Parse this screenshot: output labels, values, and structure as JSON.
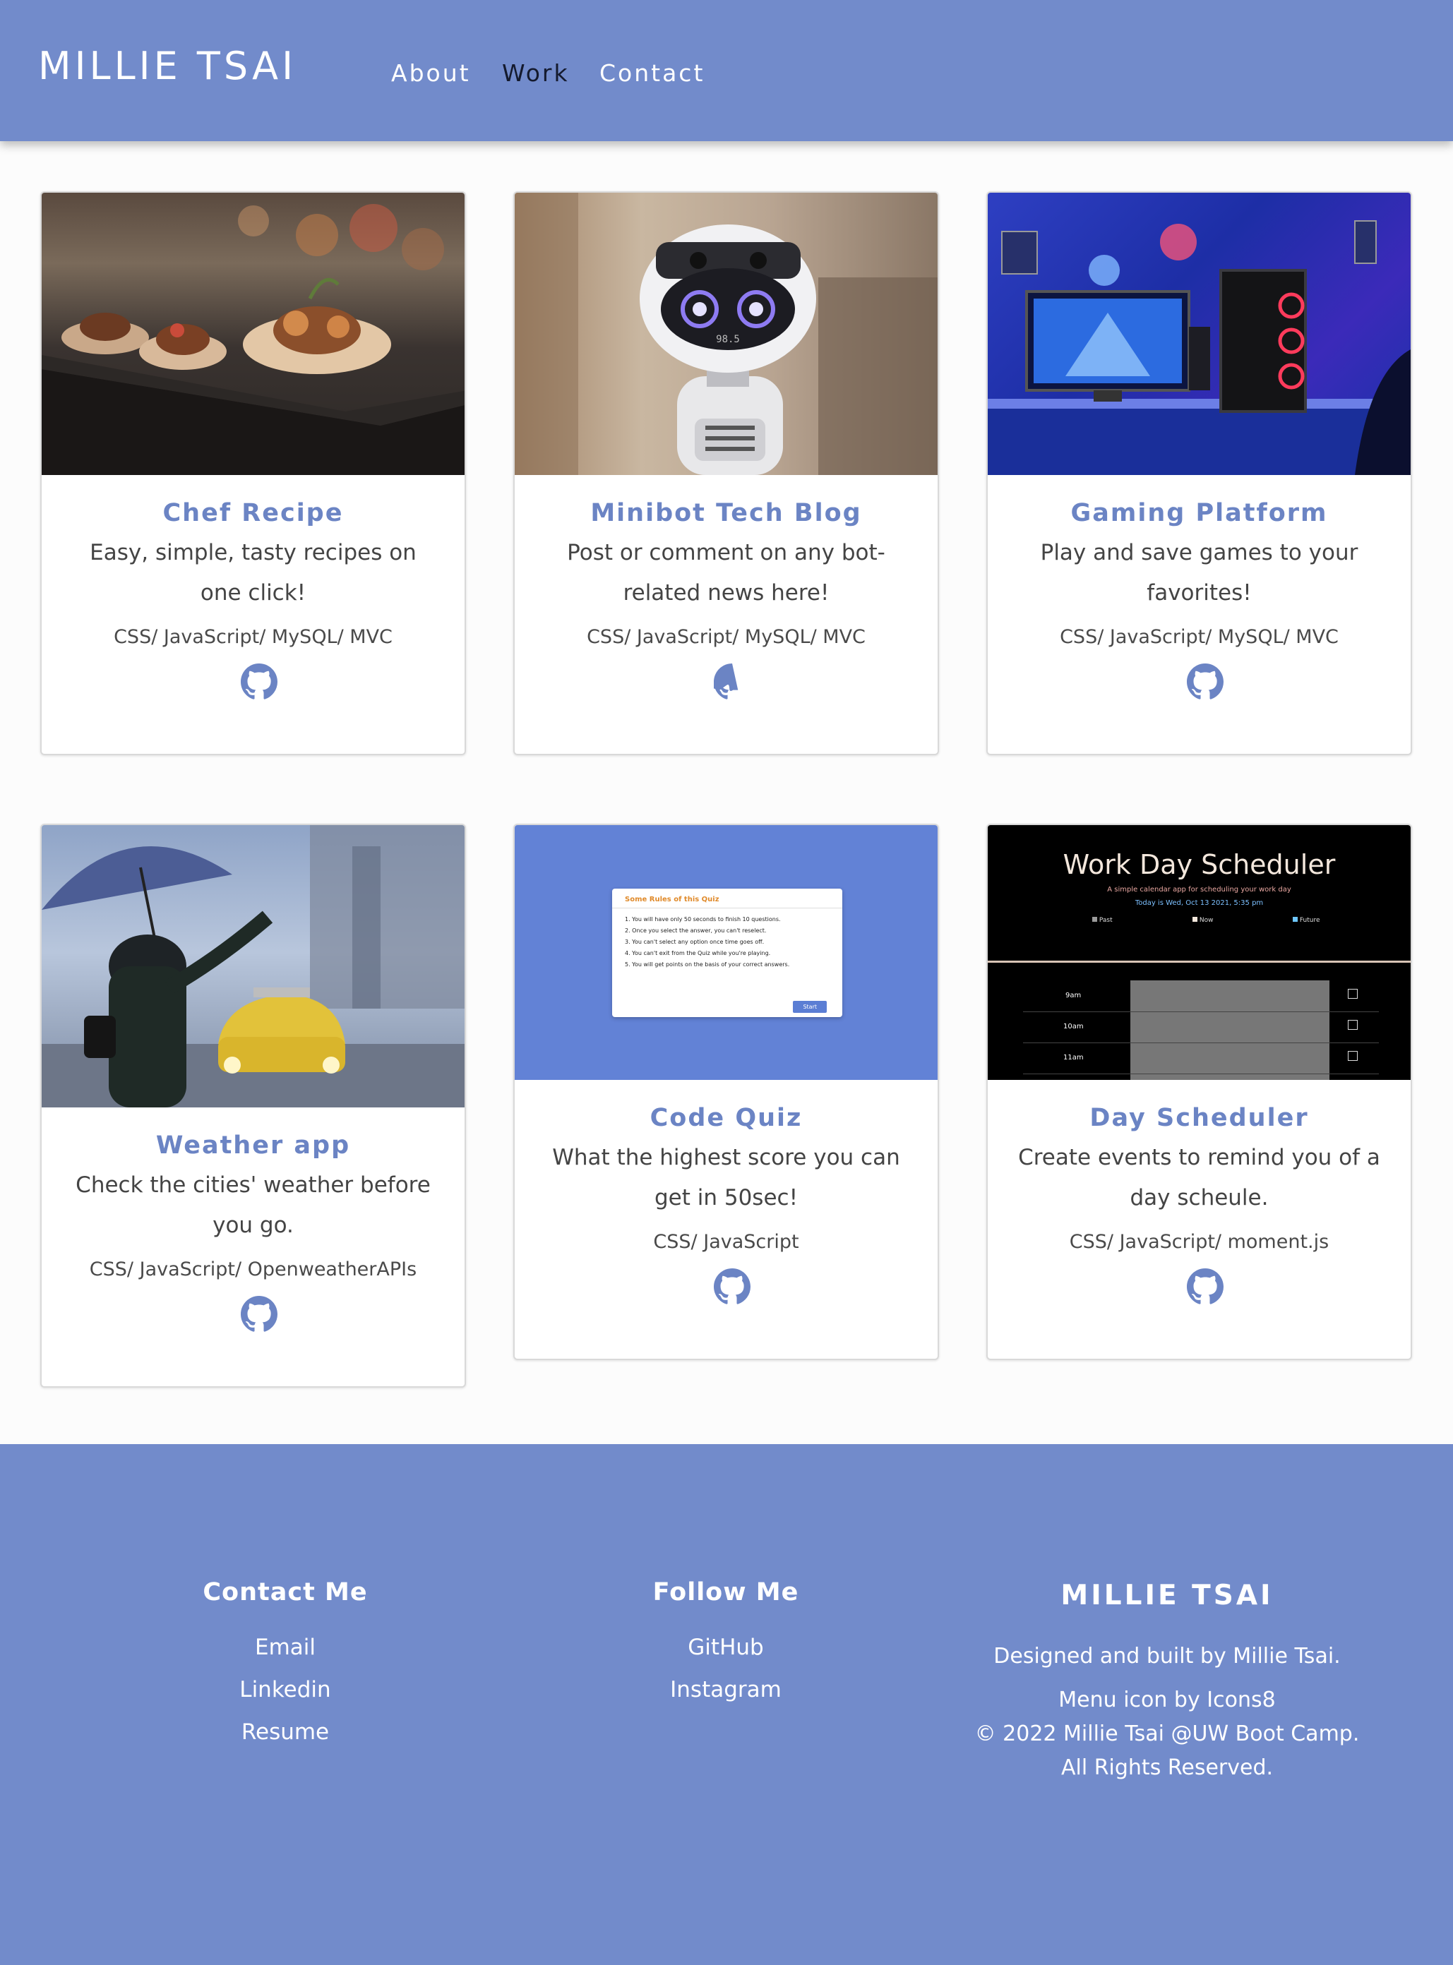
{
  "header": {
    "brand": "MILLIE TSAI",
    "nav": [
      {
        "label": "About"
      },
      {
        "label": "Work"
      },
      {
        "label": "Contact"
      }
    ],
    "active": "Work",
    "color": "#728bcb"
  },
  "projects": [
    {
      "title": "Chef Recipe",
      "description": "Easy, simple, tasty recipes on one click!",
      "tech": "CSS/ JavaScript/ MySQL/ MVC",
      "image": "food-photo",
      "icon": "github-icon"
    },
    {
      "title": "Minibot Tech Blog",
      "description": "Post or comment on any bot-related news here!",
      "tech": "CSS/ JavaScript/ MySQL/ MVC",
      "image": "robot-photo",
      "icon": "github-icon"
    },
    {
      "title": "Gaming Platform",
      "description": "Play and save games to your favorites!",
      "tech": "CSS/ JavaScript/ MySQL/ MVC",
      "image": "gaming-setup-photo",
      "icon": "github-icon"
    },
    {
      "title": "Weather app",
      "description": "Check the cities' weather before you go.",
      "tech": "CSS/ JavaScript/ OpenweatherAPIs",
      "image": "rain-umbrella-photo",
      "icon": "github-icon"
    },
    {
      "title": "Code Quiz",
      "description": "What the highest score you can get in 50sec!",
      "tech": "CSS/ JavaScript",
      "image": "quiz-screenshot",
      "icon": "github-icon"
    },
    {
      "title": "Day Scheduler",
      "description": "Create events to remind you of a day scheule.",
      "tech": "CSS/ JavaScript/ moment.js",
      "image": "scheduler-screenshot",
      "icon": "github-icon"
    }
  ],
  "quiz_preview": {
    "heading": "Some Rules of this Quiz",
    "rules": [
      "1. You will have only 50 seconds to finish 10 questions.",
      "2. Once you select the answer, you can't reselect.",
      "3. You can't select any option once time goes off.",
      "4. You can't exit from the Quiz while you're playing.",
      "5. You will get points on the basis of your correct answers."
    ],
    "button": "Start"
  },
  "scheduler_preview": {
    "title": "Work Day Scheduler",
    "subtitle": "A simple calendar app for scheduling your work day",
    "today": "Today is Wed, Oct 13 2021, 5:35 pm",
    "legend": [
      "Past",
      "Now",
      "Future"
    ],
    "hours": [
      "9am",
      "10am",
      "11am"
    ]
  },
  "robot_preview": {
    "display": "98.5"
  },
  "footer": {
    "contact": {
      "heading": "Contact Me",
      "links": [
        "Email",
        "Linkedin",
        "Resume"
      ]
    },
    "follow": {
      "heading": "Follow Me",
      "links": [
        "GitHub",
        "Instagram"
      ]
    },
    "brand": "MILLIE TSAI",
    "built_by": "Designed and built by Millie Tsai.",
    "credit": "Menu icon by Icons8",
    "copyright": "© 2022 Millie Tsai @UW Boot Camp. All Rights Reserved."
  }
}
